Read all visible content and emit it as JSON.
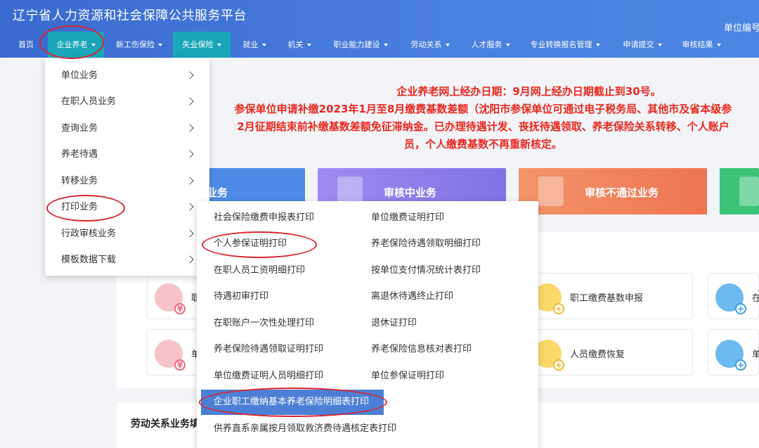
{
  "header": {
    "site_title": "辽宁省人力资源和社会保障公共服务平台",
    "unit_no_label": "单位编号"
  },
  "nav": {
    "items": [
      {
        "label": "首页",
        "has_caret": false
      },
      {
        "label": "企业养老",
        "has_caret": true,
        "active": true
      },
      {
        "label": "新工伤保险",
        "has_caret": true
      },
      {
        "label": "失业保险",
        "has_caret": true,
        "active": true
      },
      {
        "label": "就业",
        "has_caret": true
      },
      {
        "label": "机关",
        "has_caret": true
      },
      {
        "label": "职业能力建设",
        "has_caret": true
      },
      {
        "label": "劳动关系",
        "has_caret": true
      },
      {
        "label": "人才服务",
        "has_caret": true
      },
      {
        "label": "专业转换报名管理",
        "has_caret": true
      },
      {
        "label": "申请提交",
        "has_caret": true
      },
      {
        "label": "审核结果",
        "has_caret": true
      }
    ]
  },
  "notice": {
    "lines": [
      "企业养老网上经办日期：9月网上经办日期截止到30号。",
      "参保单位申请补缴2023年1月至8月缴费基数差额（沈阳市参保单位可通过电子税务局、其他市及省本级参",
      "2月征期结束前补缴基数差额免征滞纳金。已办理待遇计发、丧抚待遇领取、养老保险关系转移、个人账户",
      "员，个人缴费基数不再重新核定。"
    ]
  },
  "status_cards": [
    {
      "label": "业务",
      "color": "#4e8ae6"
    },
    {
      "label": "审核中业务",
      "color": "#8e7be8"
    },
    {
      "label": "审核不通过业务",
      "color": "#f07f5c"
    },
    {
      "label": "",
      "color": "#3cc47a"
    }
  ],
  "services": [
    {
      "label": "职",
      "color": "#f0697a"
    },
    {
      "label": "职工缴费基数申报",
      "color": "#f5b52a"
    },
    {
      "label": "在",
      "color": "#3b9ee8"
    },
    {
      "label": "单",
      "color": "#f0697a"
    },
    {
      "label": "人员缴费恢复",
      "color": "#f5b52a"
    },
    {
      "label": "单",
      "color": "#3b9ee8"
    }
  ],
  "section": {
    "title": "劳动关系业务填"
  },
  "dropdown": {
    "items": [
      {
        "label": "单位业务"
      },
      {
        "label": "在职人员业务"
      },
      {
        "label": "查询业务"
      },
      {
        "label": "养老待遇"
      },
      {
        "label": "转移业务"
      },
      {
        "label": "打印业务"
      },
      {
        "label": "行政审核业务"
      },
      {
        "label": "模板数据下载"
      }
    ]
  },
  "submenu": {
    "left": [
      {
        "label": "社会保险缴费申报表打印"
      },
      {
        "label": "个人参保证明打印"
      },
      {
        "label": "在职人员工资明细打印"
      },
      {
        "label": "待遇初审打印"
      },
      {
        "label": "在职账户一次性处理打印"
      },
      {
        "label": "养老保险待遇领取证明打印"
      },
      {
        "label": "单位缴费证明人员明细打印"
      },
      {
        "label": "企业职工缴纳基本养老保险明细表打印",
        "highlight": true
      },
      {
        "label": "供养直系亲属按月领取救济费待遇核定表打印"
      }
    ],
    "right": [
      {
        "label": "单位缴费证明打印"
      },
      {
        "label": "养老保险待遇领取明细打印"
      },
      {
        "label": "按单位支付情况统计表打印"
      },
      {
        "label": "离退休待遇终止打印"
      },
      {
        "label": "退休证打印"
      },
      {
        "label": "养老保险信息核对表打印"
      },
      {
        "label": "单位参保证明打印"
      }
    ]
  },
  "annotation_color": "#d8262e"
}
